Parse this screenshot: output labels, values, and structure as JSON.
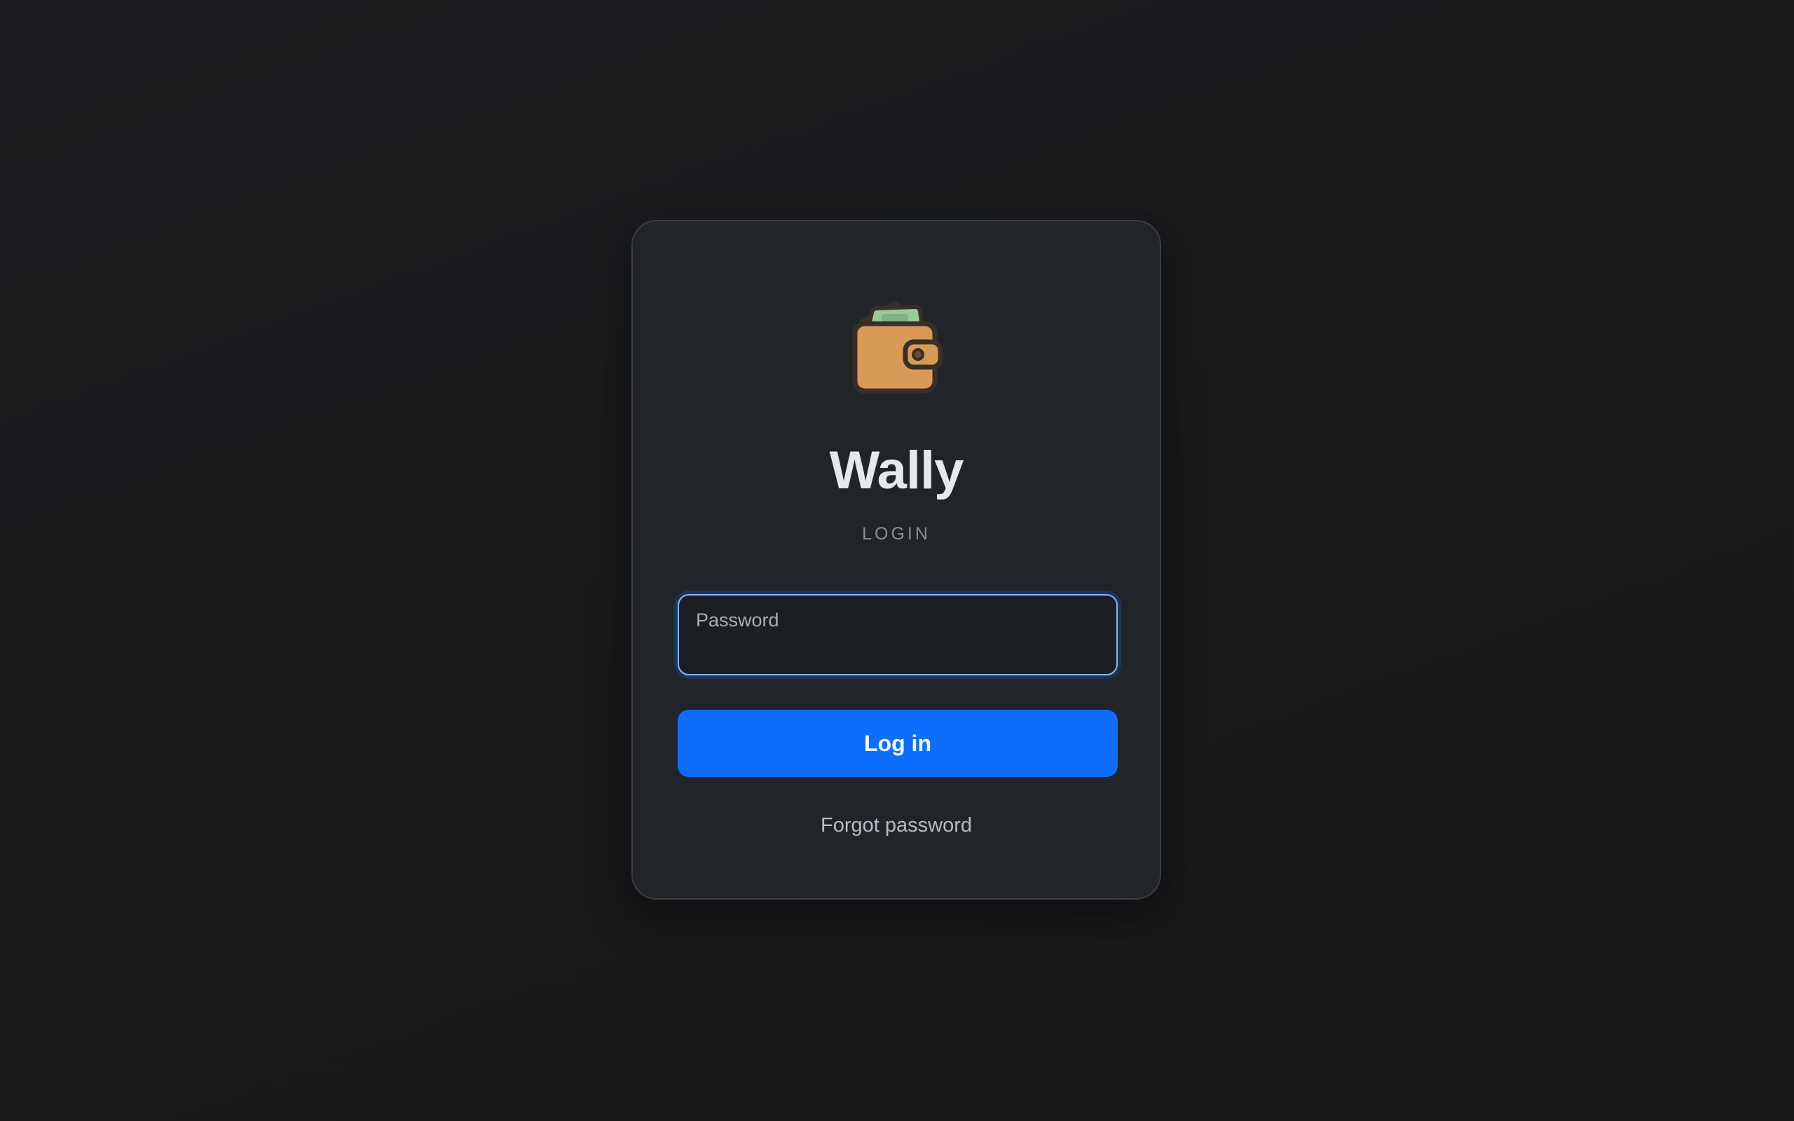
{
  "app": {
    "title": "Wally",
    "subtitle": "LOGIN",
    "logo_icon": "wallet-icon"
  },
  "form": {
    "password": {
      "label": "Password",
      "value": ""
    },
    "login_button_label": "Log in",
    "forgot_link_label": "Forgot password"
  },
  "colors": {
    "background": "#1a1b1d",
    "card": "#212429",
    "accent": "#0d6efd",
    "focus_border": "#8ab4f8",
    "title": "#e6e8eb",
    "wallet": "#d99a57",
    "cash": "#8fc28f"
  }
}
